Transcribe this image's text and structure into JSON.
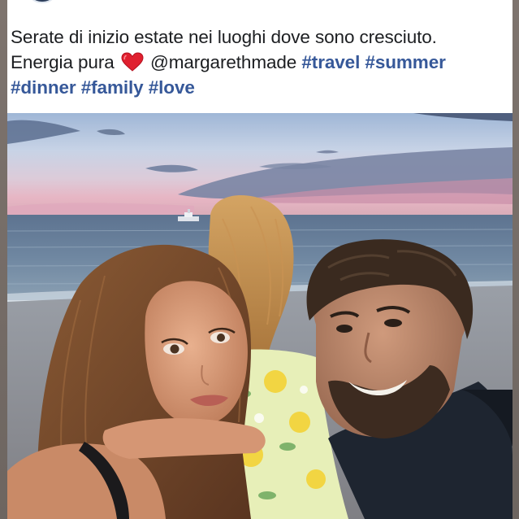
{
  "post": {
    "caption_line1": "Serate di inizio estate nei luoghi dove sono cresciuto.",
    "caption_line2_prefix": "Energia pura",
    "mention": "@margarethmade",
    "hashtags_line2": [
      "#travel",
      "#summer"
    ],
    "hashtags_line3": [
      "#dinner",
      "#family",
      "#love"
    ],
    "heart_icon": "red-heart-emoji",
    "photo_description_icon": "selfie-photo"
  },
  "colors": {
    "hashtag": "#365899",
    "text": "#1c1e21",
    "heart": "#e0202f",
    "background": "#ffffff"
  }
}
